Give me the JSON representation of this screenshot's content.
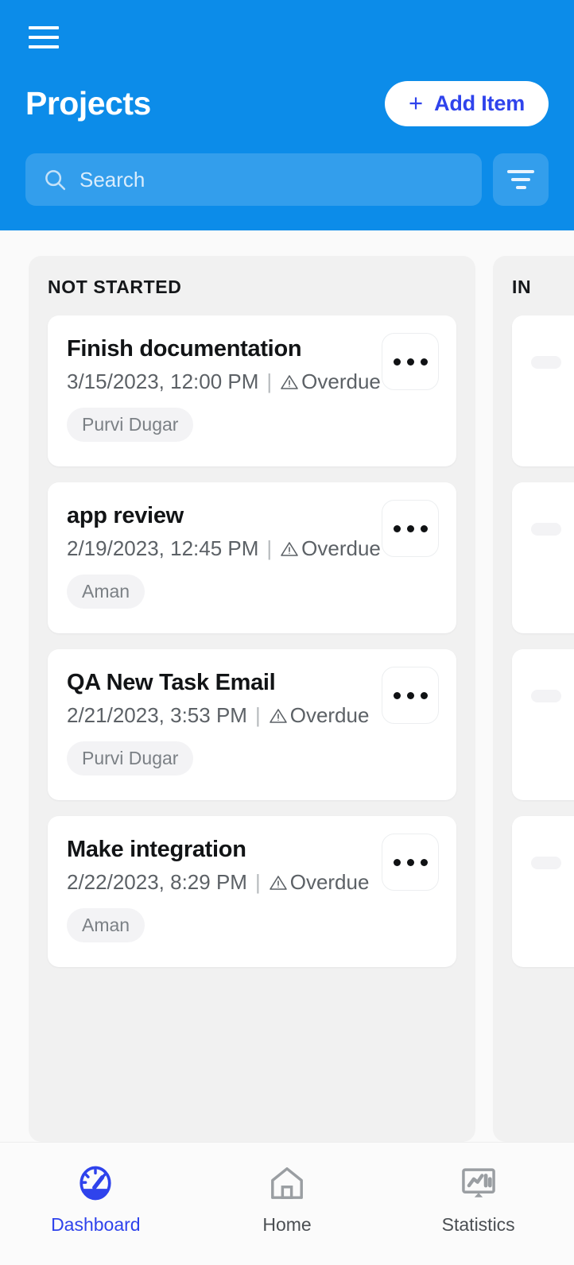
{
  "colors": {
    "header_bg": "#0c8ce9",
    "accent": "#2f43ec",
    "column_bg": "#f1f1f1",
    "page_bg": "#fafafa",
    "card_bg": "#ffffff",
    "muted_text": "#5c6166",
    "chip_bg": "#f3f3f5"
  },
  "header": {
    "menu_icon": "hamburger-icon",
    "title": "Projects",
    "add_item": {
      "plus": "+",
      "label": "Add Item",
      "icon": "plus-icon"
    },
    "search": {
      "placeholder": "Search",
      "value": "",
      "icon": "search-icon"
    },
    "filter": {
      "icon": "filter-icon"
    }
  },
  "board": {
    "columns": [
      {
        "title": "NOT STARTED",
        "cards": [
          {
            "title": "Finish documentation",
            "due": "3/15/2023, 12:00 PM",
            "separator": "|",
            "status": "Overdue",
            "status_icon": "warning-triangle-icon",
            "assignee": "Purvi Dugar",
            "menu_icon": "ellipsis-icon"
          },
          {
            "title": "app review",
            "due": "2/19/2023, 12:45 PM",
            "separator": "|",
            "status": "Overdue",
            "status_icon": "warning-triangle-icon",
            "assignee": "Aman",
            "menu_icon": "ellipsis-icon"
          },
          {
            "title": "QA New Task Email",
            "due": "2/21/2023, 3:53 PM",
            "separator": "|",
            "status": "Overdue",
            "status_icon": "warning-triangle-icon",
            "assignee": "Purvi Dugar",
            "menu_icon": "ellipsis-icon"
          },
          {
            "title": "Make integration",
            "due": "2/22/2023, 8:29 PM",
            "separator": "|",
            "status": "Overdue",
            "status_icon": "warning-triangle-icon",
            "assignee": "Aman",
            "menu_icon": "ellipsis-icon"
          }
        ]
      },
      {
        "title": "IN",
        "cards": [
          {
            "title": "",
            "due": "",
            "separator": "",
            "status": "",
            "assignee": "",
            "menu_icon": "ellipsis-icon"
          },
          {
            "title": "",
            "due": "",
            "separator": "",
            "status": "",
            "assignee": "",
            "menu_icon": "ellipsis-icon"
          },
          {
            "title": "",
            "due": "",
            "separator": "",
            "status": "",
            "assignee": "",
            "menu_icon": "ellipsis-icon"
          },
          {
            "title": "",
            "due": "",
            "separator": "",
            "status": "",
            "assignee": "",
            "menu_icon": "ellipsis-icon"
          }
        ]
      }
    ]
  },
  "bottom_nav": {
    "items": [
      {
        "label": "Dashboard",
        "icon": "speedometer-icon",
        "active": true
      },
      {
        "label": "Home",
        "icon": "home-icon",
        "active": false
      },
      {
        "label": "Statistics",
        "icon": "chart-monitor-icon",
        "active": false
      }
    ]
  }
}
